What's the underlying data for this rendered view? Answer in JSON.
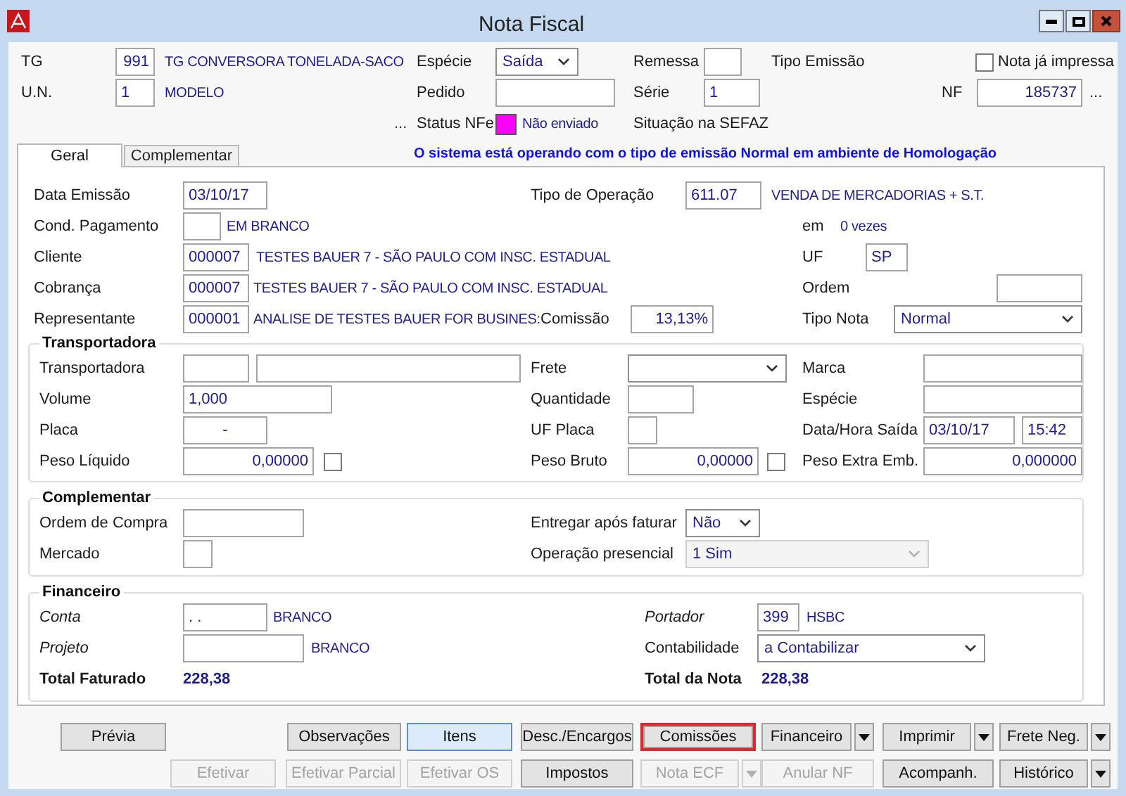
{
  "window": {
    "title": "Nota Fiscal"
  },
  "header": {
    "rows": [
      [
        {
          "kind": "label",
          "text": "TG"
        },
        {
          "kind": "input",
          "value": "991"
        },
        {
          "kind": "value",
          "text": "TG CONVERSORA TONELADA-SACO"
        },
        {
          "kind": "label",
          "text": "Espécie"
        },
        {
          "kind": "select",
          "value": "Saída",
          "disabled": false
        },
        {
          "kind": "label",
          "text": "Remessa"
        },
        {
          "kind": "input"
        },
        {
          "kind": "label",
          "text": "Tipo Emissão"
        },
        {
          "kind": "checkbox",
          "label": "Nota já impressa",
          "checked": false
        }
      ],
      [
        {
          "kind": "label",
          "text": "U.N."
        },
        {
          "kind": "input",
          "value": "1"
        },
        {
          "kind": "value",
          "text": "MODELO"
        },
        {
          "kind": "label",
          "text": "Pedido"
        },
        {
          "kind": "input"
        },
        {
          "kind": "label",
          "text": "Série"
        },
        {
          "kind": "input",
          "value": "1"
        },
        {
          "kind": "label",
          "text": "NF"
        },
        {
          "kind": "input",
          "value": "185737"
        },
        {
          "kind": "ellipsis",
          "text": "..."
        }
      ],
      [
        "",
        "",
        {
          "kind": "ellipsis",
          "text": "..."
        },
        {
          "kind": "label",
          "text": "Status NFe"
        },
        {
          "kind": "status",
          "color": "#ff00ff",
          "text": "Não enviado"
        },
        {
          "kind": "label",
          "text": "Situação na SEFAZ"
        }
      ]
    ]
  },
  "tabs": [
    {
      "label": "Geral",
      "selected": true
    },
    {
      "label": "Complementar",
      "selected": false
    }
  ],
  "notice": "O sistema está operando com o tipo de emissão Normal em ambiente de Homologação",
  "general": {
    "rows": [
      [
        {
          "kind": "label",
          "text": "Data Emissão"
        },
        {
          "kind": "input",
          "value": "03/10/17"
        },
        "",
        {
          "kind": "label",
          "text": "Tipo de Operação"
        },
        {
          "kind": "input",
          "value": "611.07"
        },
        {
          "kind": "value",
          "text": "VENDA DE MERCADORIAS + S.T."
        }
      ],
      [
        {
          "kind": "label",
          "text": "Cond. Pagamento"
        },
        {
          "kind": "input"
        },
        {
          "kind": "value",
          "text": "EM BRANCO"
        },
        "",
        "",
        "",
        {
          "kind": "label",
          "text": "em"
        },
        {
          "kind": "value",
          "text": "0  vezes"
        }
      ],
      [
        {
          "kind": "label",
          "text": "Cliente"
        },
        {
          "kind": "input",
          "value": "000007"
        },
        {
          "kind": "value",
          "text": "TESTES BAUER 7 - SÃO PAULO COM INSC. ESTADUAL"
        },
        "",
        "",
        "",
        {
          "kind": "label",
          "text": "UF"
        },
        {
          "kind": "input",
          "value": "SP"
        }
      ],
      [
        {
          "kind": "label",
          "text": "Cobrança"
        },
        {
          "kind": "input",
          "value": "000007"
        },
        {
          "kind": "value",
          "text": "TESTES BAUER 7 - SÃO PAULO COM INSC. ESTADUAL"
        },
        "",
        "",
        "",
        {
          "kind": "label",
          "text": "Ordem"
        },
        {
          "kind": "input"
        }
      ],
      [
        {
          "kind": "label",
          "text": "Representante"
        },
        {
          "kind": "input",
          "value": "000001"
        },
        {
          "kind": "value",
          "text": "ANALISE DE TESTES BAUER FOR BUSINES:"
        },
        {
          "kind": "label",
          "text": "Comissão"
        },
        {
          "kind": "input",
          "value": "13,13%"
        },
        "",
        {
          "kind": "label",
          "text": "Tipo Nota"
        },
        "",
        {
          "kind": "select",
          "value": "Normal",
          "disabled": false
        }
      ]
    ]
  },
  "groups": [
    {
      "title": "Transportadora",
      "rows": [
        [
          {
            "kind": "label",
            "text": "Transportadora"
          },
          {
            "kind": "input"
          },
          {
            "kind": "input"
          },
          {
            "kind": "label",
            "text": "Frete"
          },
          {
            "kind": "select",
            "disabled": false
          },
          "",
          {
            "kind": "label",
            "text": "Marca"
          },
          {
            "kind": "input"
          }
        ],
        [
          {
            "kind": "label",
            "text": "Volume"
          },
          {
            "kind": "input",
            "value": "1,000"
          },
          "",
          {
            "kind": "label",
            "text": "Quantidade"
          },
          {
            "kind": "input"
          },
          "",
          {
            "kind": "label",
            "text": "Espécie"
          },
          {
            "kind": "input"
          }
        ],
        [
          {
            "kind": "label",
            "text": "Placa"
          },
          {
            "kind": "input",
            "value": "-"
          },
          "",
          {
            "kind": "label",
            "text": "UF Placa"
          },
          {
            "kind": "input"
          },
          "",
          {
            "kind": "label",
            "text": "Data/Hora Saída"
          },
          {
            "kind": "input",
            "value": "03/10/17"
          },
          {
            "kind": "input",
            "value": "15:42"
          }
        ],
        [
          {
            "kind": "label",
            "text": "Peso Líquido"
          },
          {
            "kind": "input",
            "value": "0,00000"
          },
          {
            "kind": "checkbox",
            "checked": false
          },
          {
            "kind": "label",
            "text": "Peso Bruto"
          },
          {
            "kind": "input",
            "value": "0,00000"
          },
          {
            "kind": "checkbox",
            "checked": false
          },
          {
            "kind": "label",
            "text": "Peso Extra Emb."
          },
          "",
          {
            "kind": "input",
            "value": "0,000000"
          }
        ]
      ]
    },
    {
      "title": "Complementar",
      "rows": [
        [
          {
            "kind": "label",
            "text": "Ordem de Compra"
          },
          {
            "kind": "input"
          },
          {
            "kind": "label",
            "text": "Entregar após faturar"
          },
          {
            "kind": "select",
            "value": "Não",
            "disabled": false
          }
        ],
        [
          {
            "kind": "label",
            "text": "Mercado"
          },
          {
            "kind": "input"
          },
          {
            "kind": "label",
            "text": "Operação presencial"
          },
          {
            "kind": "select",
            "value": "1 Sim",
            "disabled": true
          }
        ]
      ]
    },
    {
      "title": "Financeiro",
      "rows": [
        [
          {
            "kind": "italic-label",
            "text": "Conta"
          },
          {
            "kind": "input",
            "value": ". ."
          },
          {
            "kind": "value",
            "text": "BRANCO"
          },
          {
            "kind": "italic-label",
            "text": "Portador"
          },
          {
            "kind": "input",
            "value": "399"
          },
          {
            "kind": "value",
            "text": "HSBC"
          }
        ],
        [
          {
            "kind": "italic-label",
            "text": "Projeto"
          },
          {
            "kind": "input"
          },
          {
            "kind": "value",
            "text": "BRANCO"
          },
          {
            "kind": "label",
            "text": "Contabilidade"
          },
          {
            "kind": "select",
            "value": "a Contabilizar",
            "disabled": false
          }
        ],
        [
          {
            "kind": "bold-label",
            "text": "Total Faturado"
          },
          {
            "kind": "bold-value",
            "text": "228,38"
          },
          "",
          {
            "kind": "bold-label",
            "text": "Total da Nota"
          },
          {
            "kind": "bold-value",
            "text": "228,38"
          }
        ]
      ]
    }
  ],
  "buttons": [
    [
      {
        "label": "Prévia",
        "disabled": false,
        "focused": false,
        "highlighted": false,
        "menu": false
      },
      {
        "label": "Observações",
        "disabled": false,
        "focused": false,
        "highlighted": false,
        "menu": false
      },
      {
        "label": "Itens",
        "disabled": false,
        "focused": true,
        "highlighted": false,
        "menu": false
      },
      {
        "label": "Desc./Encargos",
        "disabled": false,
        "focused": false,
        "highlighted": false,
        "menu": false
      },
      {
        "label": "Comissões",
        "disabled": false,
        "focused": false,
        "highlighted": true,
        "menu": false
      },
      {
        "label": "Financeiro",
        "disabled": false,
        "focused": false,
        "highlighted": false,
        "menu": true
      },
      {
        "label": "Imprimir",
        "disabled": false,
        "focused": false,
        "highlighted": false,
        "menu": true
      },
      {
        "label": "Frete Neg.",
        "disabled": false,
        "focused": false,
        "highlighted": false,
        "menu": true
      }
    ],
    [
      {
        "label": "Efetivar",
        "disabled": true,
        "focused": false,
        "highlighted": false,
        "menu": false
      },
      {
        "label": "Efetivar Parcial",
        "disabled": true,
        "focused": false,
        "highlighted": false,
        "menu": false
      },
      {
        "label": "Efetivar OS",
        "disabled": true,
        "focused": false,
        "highlighted": false,
        "menu": false
      },
      {
        "label": "Impostos",
        "disabled": false,
        "focused": false,
        "highlighted": false,
        "menu": false
      },
      {
        "label": "Nota ECF",
        "disabled": true,
        "focused": false,
        "highlighted": false,
        "menu": true
      },
      {
        "label": "Anular NF",
        "disabled": true,
        "focused": false,
        "highlighted": false,
        "menu": false
      },
      {
        "label": "Acompanh.",
        "disabled": false,
        "focused": false,
        "highlighted": false,
        "menu": false
      },
      {
        "label": "Histórico",
        "disabled": false,
        "focused": false,
        "highlighted": false,
        "menu": true
      }
    ]
  ]
}
